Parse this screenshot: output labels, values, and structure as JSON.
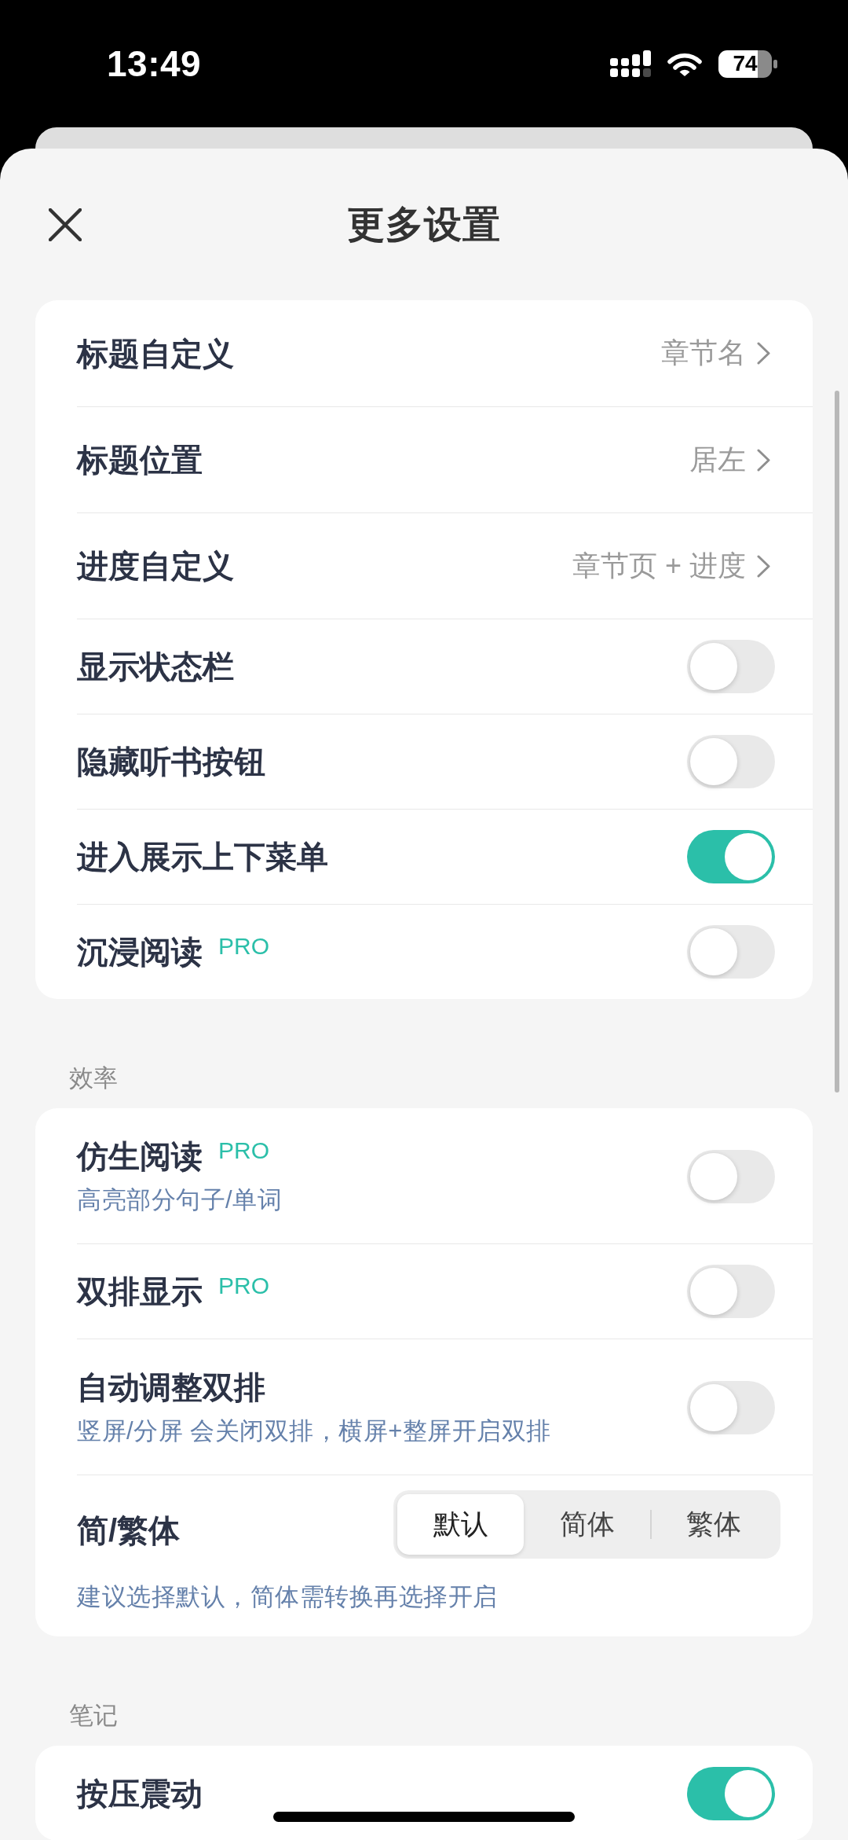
{
  "status_bar": {
    "time": "13:49",
    "battery": "74"
  },
  "header": {
    "title": "更多设置"
  },
  "sections": [
    {
      "rows": [
        {
          "kind": "link",
          "label": "标题自定义",
          "value": "章节名"
        },
        {
          "kind": "link",
          "label": "标题位置",
          "value": "居左"
        },
        {
          "kind": "link",
          "label": "进度自定义",
          "value": "章节页 + 进度"
        },
        {
          "kind": "toggle",
          "label": "显示状态栏",
          "on": false
        },
        {
          "kind": "toggle",
          "label": "隐藏听书按钮",
          "on": false
        },
        {
          "kind": "toggle",
          "label": "进入展示上下菜单",
          "on": true
        },
        {
          "kind": "toggle",
          "label": "沉浸阅读",
          "tag": "PRO",
          "on": false
        }
      ]
    },
    {
      "title": "效率",
      "rows": [
        {
          "kind": "toggle",
          "label": "仿生阅读",
          "tag": "PRO",
          "subtitle": "高亮部分句子/单词",
          "on": false
        },
        {
          "kind": "toggle",
          "label": "双排显示",
          "tag": "PRO",
          "on": false
        },
        {
          "kind": "toggle",
          "label": "自动调整双排",
          "subtitle": "竖屏/分屏 会关闭双排，横屏+整屏开启双排",
          "on": false
        },
        {
          "kind": "segmented",
          "label": "简/繁体",
          "options": [
            {
              "label": "默认",
              "selected": true
            },
            {
              "label": "简体",
              "selected": false
            },
            {
              "label": "繁体",
              "selected": false
            }
          ],
          "note": "建议选择默认，简体需转换再选择开启"
        }
      ]
    },
    {
      "title": "笔记",
      "rows": [
        {
          "kind": "toggle",
          "label": "按压震动",
          "on": true
        }
      ]
    }
  ]
}
